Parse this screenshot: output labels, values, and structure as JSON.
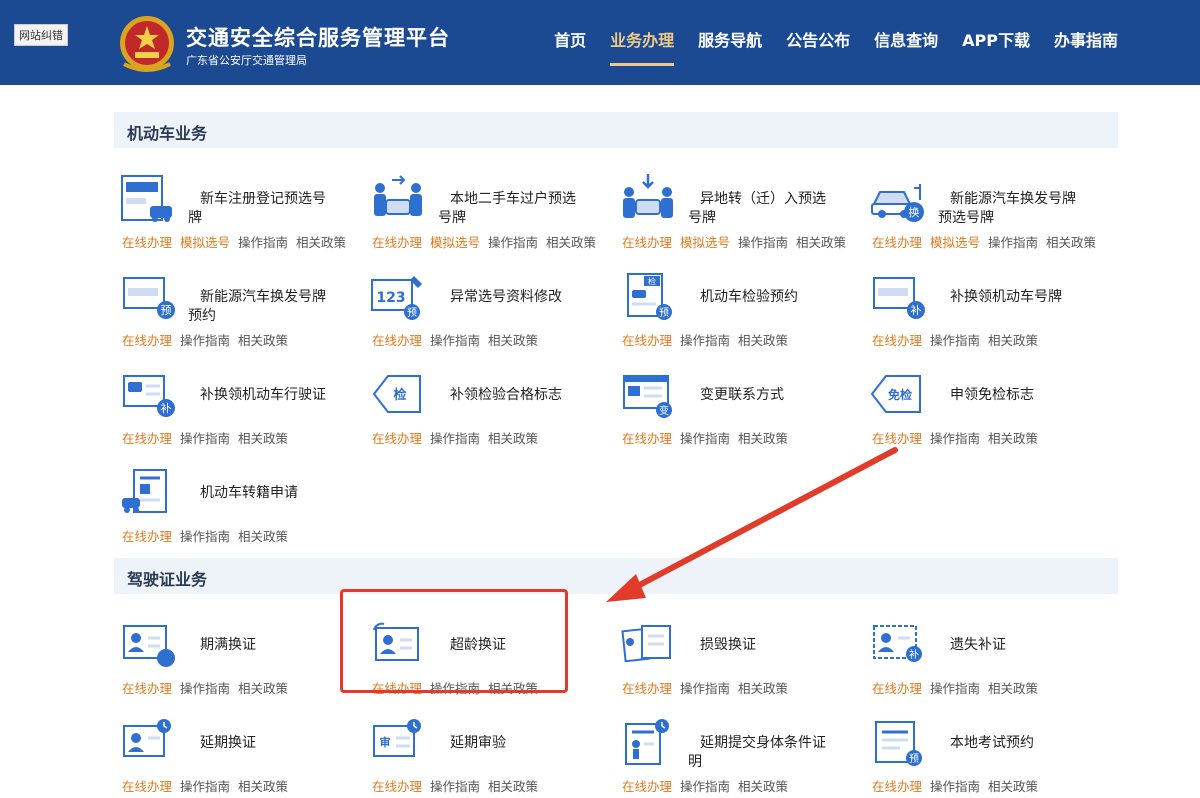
{
  "header": {
    "site_nav": "网站纠错",
    "title": "交通安全综合服务管理平台",
    "subtitle": "广东省公安厅交通管理局",
    "nav": [
      "首页",
      "业务办理",
      "服务导航",
      "公告公布",
      "信息查询",
      "APP下载",
      "办事指南"
    ],
    "active_nav": "业务办理"
  },
  "sections": {
    "vehicle": "机动车业务",
    "license": "驾驶证业务"
  },
  "links": {
    "online": "在线办理",
    "sim": "模拟选号",
    "guide": "操作指南",
    "policy": "相关政策"
  },
  "vehicle_services": [
    {
      "name": "新车注册登记预选号牌"
    },
    {
      "name": "本地二手车过户预选号牌"
    },
    {
      "name": "异地转（迁）入预选号牌"
    },
    {
      "name": "新能源汽车换发号牌预选号牌"
    },
    {
      "name": "新能源汽车换发号牌预约"
    },
    {
      "name": "异常选号资料修改"
    },
    {
      "name": "机动车检验预约"
    },
    {
      "name": "补换领机动车号牌"
    },
    {
      "name": "补换领机动车行驶证"
    },
    {
      "name": "补领检验合格标志"
    },
    {
      "name": "变更联系方式"
    },
    {
      "name": "申领免检标志"
    },
    {
      "name": "机动车转籍申请"
    }
  ],
  "license_services": [
    {
      "name": "期满换证"
    },
    {
      "name": "超龄换证"
    },
    {
      "name": "损毁换证"
    },
    {
      "name": "遗失补证"
    },
    {
      "name": "延期换证"
    },
    {
      "name": "延期审验"
    },
    {
      "name": "延期提交身体条件证明"
    },
    {
      "name": "本地考试预约"
    }
  ],
  "icon_badges": {
    "yu": "预",
    "jian": "检",
    "bu": "补",
    "huan": "换",
    "bian": "变",
    "shen": "审",
    "mianjian": "免检",
    "num": "123"
  },
  "colors": {
    "header_bg": "#1b4a93",
    "active": "#f0c98a",
    "link_orange": "#e07a1f",
    "icon_blue": "#2f6fd0",
    "highlight_red": "#e23b2a"
  }
}
